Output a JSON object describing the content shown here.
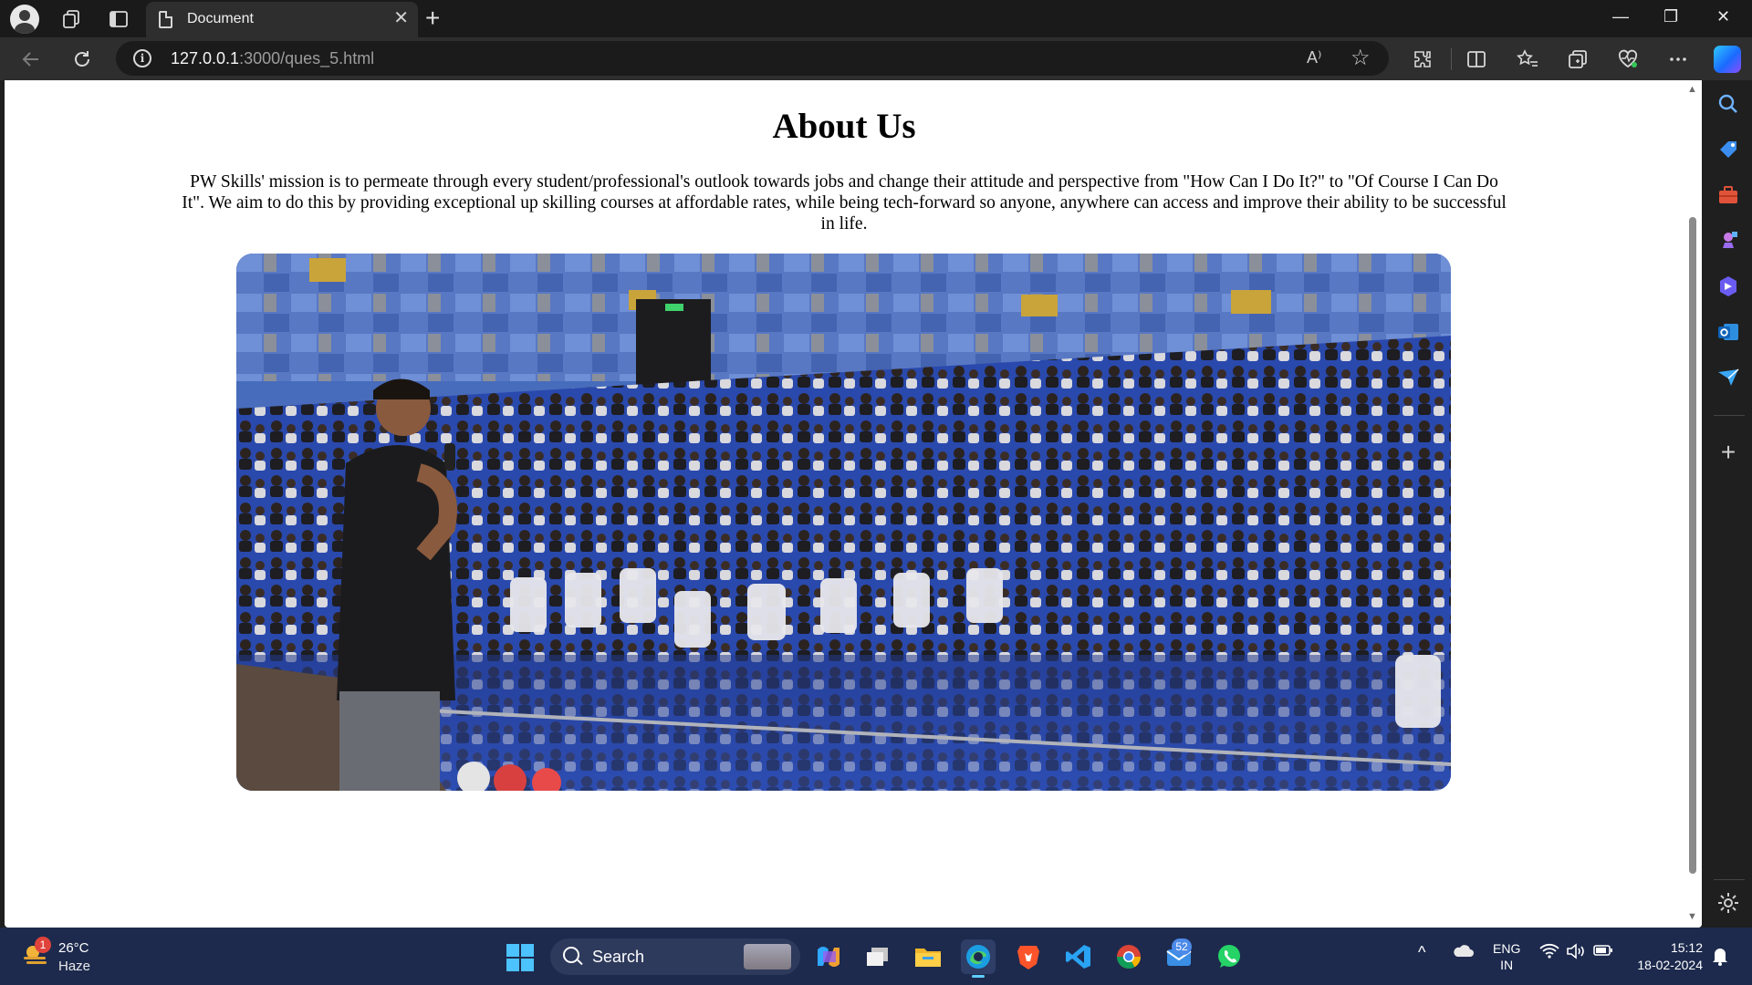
{
  "browser": {
    "tab_title": "Document",
    "tab_close_glyph": "✕",
    "new_tab_glyph": "+",
    "url_host": "127.0.0.1",
    "url_rest": ":3000/ques_5.html",
    "read_aloud_glyph": "A⁾",
    "window_controls": [
      "—",
      "❐",
      "✕"
    ],
    "icons": [
      "profile-icon",
      "workspaces-icon",
      "tab-actions-icon",
      "page-icon",
      "back-icon",
      "reload-icon",
      "site-info-icon",
      "read-aloud-icon",
      "favorite-star-icon",
      "extensions-icon",
      "split-screen-icon",
      "favorites-icon",
      "collections-icon",
      "browser-essentials-icon",
      "more-icon",
      "copilot-icon"
    ]
  },
  "page": {
    "title": "About Us",
    "mission": "PW Skills' mission is to permeate through every student/professional's outlook towards jobs and change their attitude and perspective from \"How Can I Do It?\" to \"Of Course I Can Do It\". We aim to do this by providing exceptional up skilling courses at affordable rates, while being tech-forward so anyone, anywhere can access and improve their ability to be successful in life."
  },
  "sidebar": {
    "icons": [
      "search-icon",
      "shopping-icon",
      "tools-icon",
      "games-icon",
      "copilot-designer-icon",
      "outlook-icon",
      "send-icon",
      "add-icon",
      "settings-icon"
    ],
    "add_glyph": "+"
  },
  "taskbar": {
    "weather": {
      "temp": "26°C",
      "condition": "Haze",
      "badge": "1"
    },
    "search_label": "Search",
    "apps_badge": "52",
    "language": {
      "line1": "ENG",
      "line2": "IN"
    },
    "time": "15:12",
    "date": "18-02-2024",
    "tray_chevron": "^"
  },
  "colors": {
    "accent": "#4cc2ff",
    "taskbar_bg": "#1d2a4d",
    "browser_bg": "#1f1f1f",
    "page_bg": "#ffffff"
  }
}
